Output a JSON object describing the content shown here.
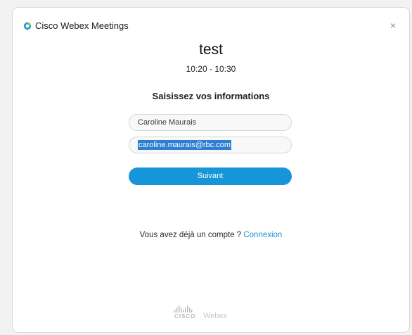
{
  "window": {
    "app_title": "Cisco Webex Meetings",
    "close_icon": "×"
  },
  "meeting": {
    "title": "test",
    "time": "10:20 - 10:30"
  },
  "form": {
    "heading": "Saisissez vos informations",
    "name_value": "Caroline Maurais",
    "email_value": "caroline.maurais@rbc.com",
    "next_label": "Suivant"
  },
  "account": {
    "prompt": "Vous avez déjà un compte ? ",
    "login_link": "Connexion"
  },
  "footer": {
    "cisco": "CISCO",
    "webex": "Webex"
  },
  "colors": {
    "accent": "#1696d8",
    "link": "#1a8fd0",
    "selection": "#2e7fd1"
  },
  "icons": {
    "app_logo": "webex-logo-icon",
    "close": "close-icon",
    "footer_logo": "cisco-logo-icon"
  }
}
